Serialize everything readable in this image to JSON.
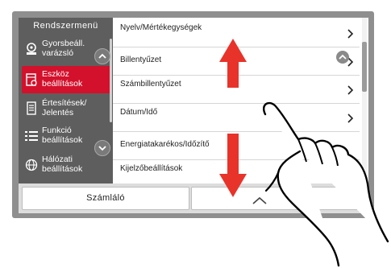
{
  "sidebar": {
    "title": "Rendszermenü",
    "items": [
      {
        "label": "Gyorsbeáll.\nvarázsló",
        "icon": "wizard-icon",
        "active": false
      },
      {
        "label": "Eszköz\nbeállítások",
        "icon": "device-settings-icon",
        "active": true
      },
      {
        "label": "Értesítések/\nJelentés",
        "icon": "report-icon",
        "active": false
      },
      {
        "label": "Funkció\nbeállítások",
        "icon": "function-list-icon",
        "active": false
      },
      {
        "label": "Hálózati\nbeállítások",
        "icon": "globe-icon",
        "active": false
      }
    ]
  },
  "list": {
    "items": [
      {
        "label": "Nyelv/Mértékegységek"
      },
      {
        "label": "Billentyűzet"
      },
      {
        "label": "Számbillentyűzet"
      },
      {
        "label": "Dátum/Idő"
      },
      {
        "label": "Energiatakarékos/Időzítő"
      },
      {
        "label": "Kijelzőbeállítások"
      }
    ]
  },
  "bottom": {
    "counter_label": "Számláló"
  },
  "colors": {
    "accent": "#d3112c",
    "gesture_arrow": "#e8332a",
    "sidebar_bg": "#5e5e5e"
  }
}
